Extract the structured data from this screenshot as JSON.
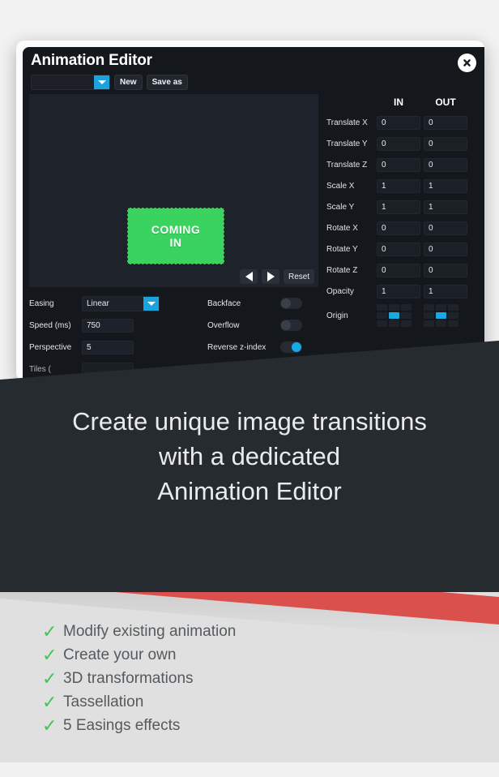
{
  "editor": {
    "title": "Animation Editor",
    "close_icon": "close-circle-icon",
    "toolbar": {
      "animation_select_value": "",
      "select_arrow_icon": "chevron-down-icon",
      "new_label": "New",
      "save_as_label": "Save as"
    },
    "stage": {
      "preview_line1": "COMING",
      "preview_line2": "IN",
      "preview_color": "#3bd35f",
      "prev_icon": "play-prev-icon",
      "play_icon": "play-icon",
      "reset_label": "Reset"
    },
    "transform_panel": {
      "columns": [
        "IN",
        "OUT"
      ],
      "rows": [
        {
          "label": "Translate X",
          "in": "0",
          "out": "0"
        },
        {
          "label": "Translate Y",
          "in": "0",
          "out": "0"
        },
        {
          "label": "Translate Z",
          "in": "0",
          "out": "0"
        },
        {
          "label": "Scale X",
          "in": "1",
          "out": "1"
        },
        {
          "label": "Scale Y",
          "in": "1",
          "out": "1"
        },
        {
          "label": "Rotate X",
          "in": "0",
          "out": "0"
        },
        {
          "label": "Rotate Y",
          "in": "0",
          "out": "0"
        },
        {
          "label": "Rotate Z",
          "in": "0",
          "out": "0"
        },
        {
          "label": "Opacity",
          "in": "1",
          "out": "1"
        }
      ],
      "origin_label": "Origin",
      "origin_in_selected": 4,
      "origin_out_selected": 4,
      "accent_color": "#19a9e0"
    },
    "controls": {
      "easing_label": "Easing",
      "easing_value": "Linear",
      "speed_label": "Speed (ms)",
      "speed_value": "750",
      "perspective_label": "Perspective",
      "perspective_value": "5",
      "tiles_label": "Tiles (",
      "backface_label": "Backface",
      "backface_on": false,
      "overflow_label": "Overflow",
      "overflow_on": false,
      "reverse_z_label": "Reverse z-index",
      "reverse_z_on": true
    }
  },
  "promo": {
    "headline_line1": "Create unique image transitions",
    "headline_line2": "with a dedicated",
    "headline_line3": "Animation Editor",
    "band_color": "#d9504c"
  },
  "features": {
    "check_glyph": "✓",
    "items": [
      "Modify existing animation",
      "Create your own",
      "3D transformations",
      "Tassellation",
      "5 Easings effects"
    ]
  }
}
